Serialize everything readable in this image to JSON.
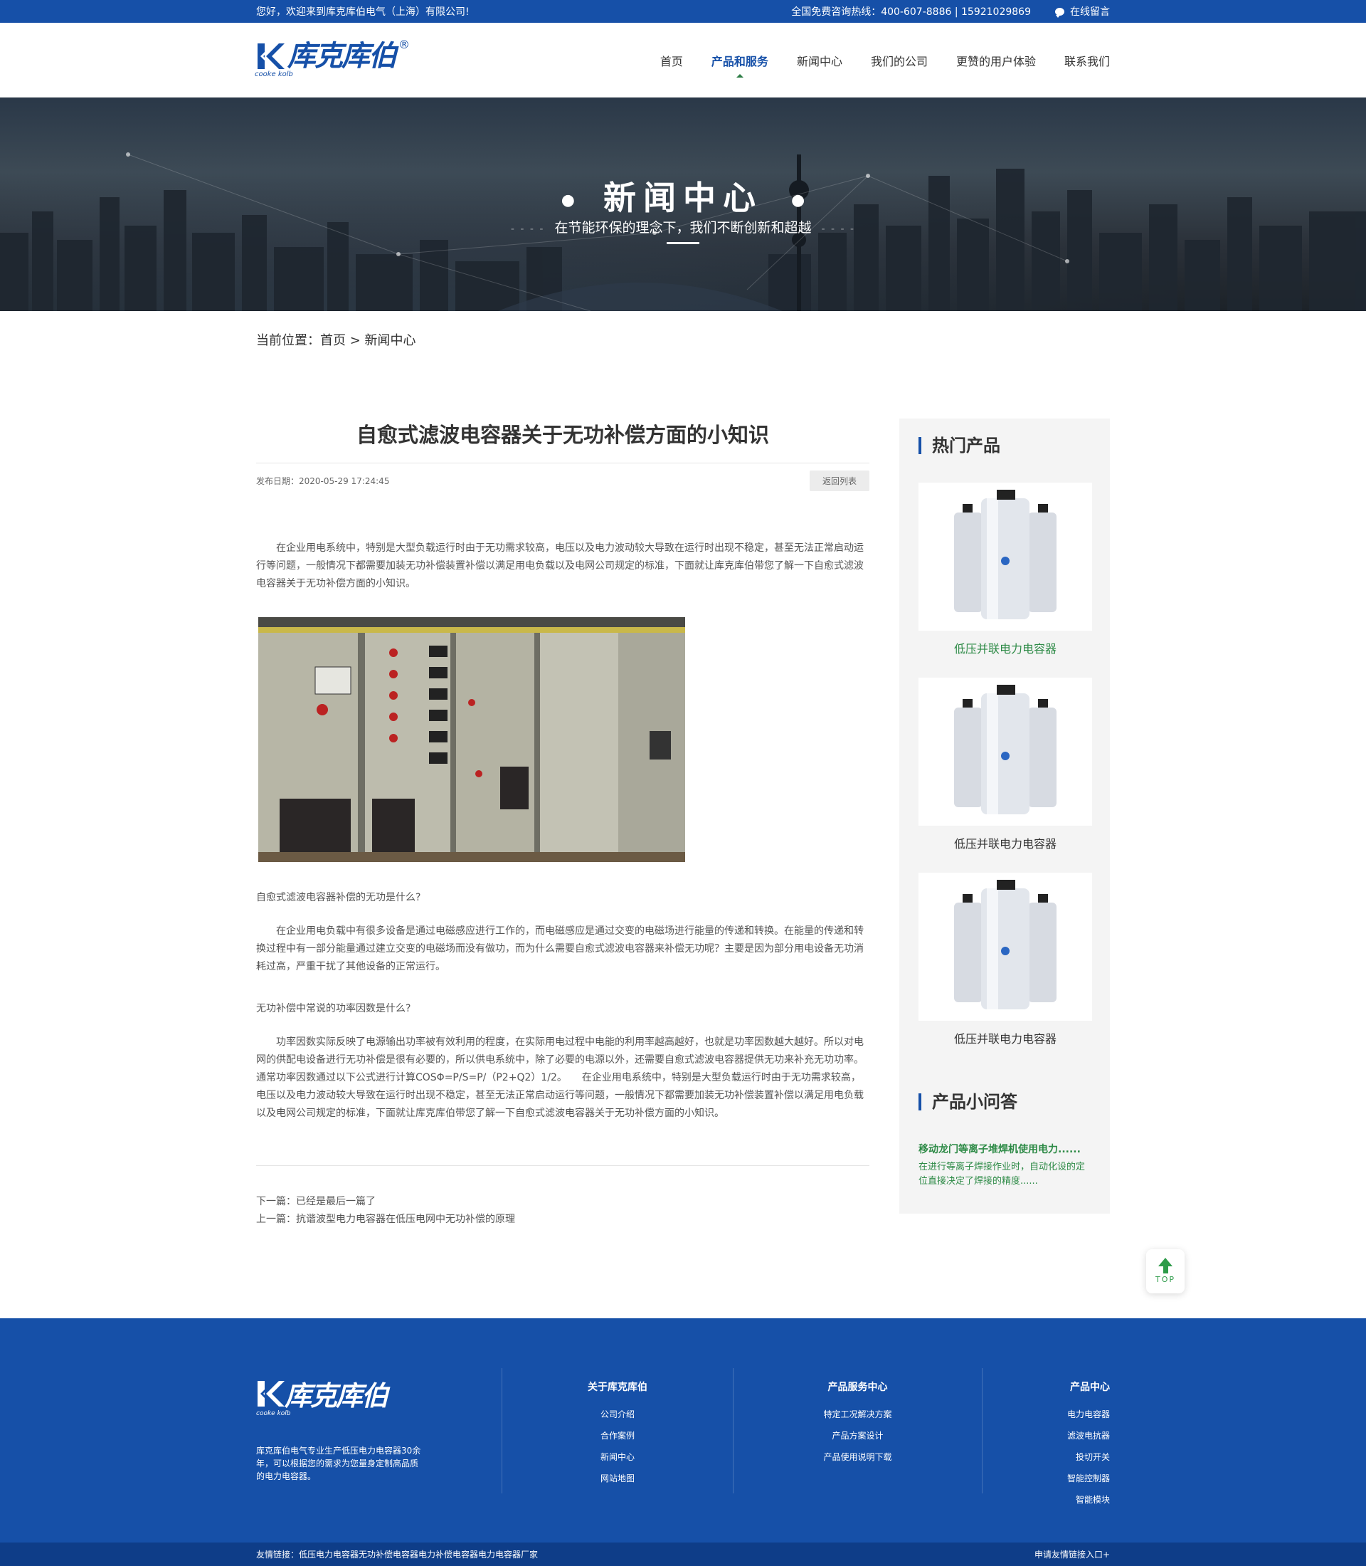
{
  "topbar": {
    "welcome": "您好，欢迎来到库克库伯电气（上海）有限公司!",
    "hotline": "全国免费咨询热线：400-607-8886 | 15921029869",
    "message": "在线留言"
  },
  "header": {
    "logo_text": "库克库伯",
    "logo_sub": "cooke kolb",
    "logo_reg": "®",
    "nav": [
      "首页",
      "产品和服务",
      "新闻中心",
      "我们的公司",
      "更赞的用户体验",
      "联系我们"
    ],
    "active_nav": "产品和服务"
  },
  "banner": {
    "title": "新闻中心",
    "subtitle": "在节能环保的理念下，我们不断创新和超越"
  },
  "breadcrumb": {
    "label": "当前位置：",
    "home": "首页",
    "sep": " > ",
    "current": "新闻中心"
  },
  "article": {
    "title": "自愈式滤波电容器关于无功补偿方面的小知识",
    "date": "发布日期：2020-05-29 17:24:45",
    "back": "返回列表",
    "p1": "在企业用电系统中，特别是大型负载运行时由于无功需求较高，电压以及电力波动较大导致在运行时出现不稳定，甚至无法正常启动运行等问题，一般情况下都需要加装无功补偿装置补偿以满足用电负载以及电网公司规定的标准，下面就让库克库伯带您了解一下自愈式滤波电容器关于无功补偿方面的小知识。",
    "q1": "自愈式滤波电容器补偿的无功是什么?",
    "p2": "在企业用电负载中有很多设备是通过电磁感应进行工作的，而电磁感应是通过交变的电磁场进行能量的传递和转换。在能量的传递和转换过程中有一部分能量通过建立交变的电磁场而没有做功，而为什么需要自愈式滤波电容器来补偿无功呢？主要是因为部分用电设备无功消耗过高，严重干扰了其他设备的正常运行。",
    "q2": "无功补偿中常说的功率因数是什么?",
    "p3": "功率因数实际反映了电源输出功率被有效利用的程度，在实际用电过程中电能的利用率越高越好，也就是功率因数越大越好。所以对电网的供配电设备进行无功补偿是很有必要的，所以供电系统中，除了必要的电源以外，还需要自愈式滤波电容器提供无功来补充无功功率。通常功率因数通过以下公式进行计算COSΦ=P/S=P/（P2+Q2）1/2。　　在企业用电系统中，特别是大型负载运行时由于无功需求较高，电压以及电力波动较大导致在运行时出现不稳定，甚至无法正常启动运行等问题，一般情况下都需要加装无功补偿装置补偿以满足用电负载以及电网公司规定的标准，下面就让库克库伯带您了解一下自愈式滤波电容器关于无功补偿方面的小知识。",
    "next": "下一篇：已经是最后一篇了",
    "prev": "上一篇：抗谐波型电力电容器在低压电网中无功补偿的原理"
  },
  "sidebar": {
    "hot_title": "热门产品",
    "products": [
      "低压并联电力电容器",
      "低压并联电力电容器",
      "低压并联电力电容器"
    ],
    "qa_title": "产品小问答",
    "qa_item_title": "移动龙门等离子堆焊机使用电力......",
    "qa_item_desc": "在进行等离子焊接作业时，自动化设的定位直接决定了焊接的精度......"
  },
  "topbtn": "TOP",
  "footer": {
    "logo_text": "库克库伯",
    "logo_sub": "cooke kolb",
    "desc": "库克库伯电气专业生产低压电力电容器30余年，可以根据您的需求为您量身定制高品质的电力电容器。",
    "col1": {
      "title": "关于库克库伯",
      "items": [
        "公司介绍",
        "合作案例",
        "新闻中心",
        "网站地图"
      ]
    },
    "col2": {
      "title": "产品服务中心",
      "items": [
        "特定工况解决方案",
        "产品方案设计",
        "产品使用说明下载"
      ]
    },
    "col3": {
      "title": "产品中心",
      "items": [
        "电力电容器",
        "滤波电抗器",
        "投切开关",
        "智能控制器",
        "智能模块"
      ]
    },
    "links": "友情链接：低压电力电容器无功补偿电容器电力补偿电容器电力电容器厂家",
    "apply": "申请友情链接入口+"
  },
  "colors": {
    "brand_blue": "#1650a8",
    "accent_green": "#2d8a46"
  }
}
